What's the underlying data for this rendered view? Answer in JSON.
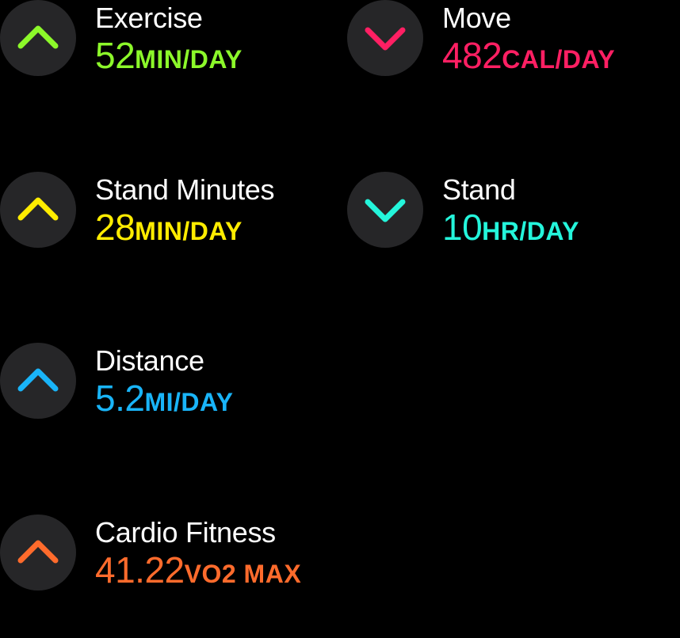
{
  "trends": [
    {
      "id": "exercise",
      "title": "Exercise",
      "value": "52",
      "unit": "MIN/DAY",
      "color": "#8cf82a",
      "direction": "up",
      "icon": "chevron-up-icon"
    },
    {
      "id": "move",
      "title": "Move",
      "value": "482",
      "unit": "CAL/DAY",
      "color": "#ff1f63",
      "direction": "down",
      "icon": "chevron-down-icon"
    },
    {
      "id": "stand-minutes",
      "title": "Stand Minutes",
      "value": "28",
      "unit": "MIN/DAY",
      "color": "#ffec00",
      "direction": "up",
      "icon": "chevron-up-icon"
    },
    {
      "id": "stand",
      "title": "Stand",
      "value": "10",
      "unit": "HR/DAY",
      "color": "#24f5db",
      "direction": "down",
      "icon": "chevron-down-icon"
    },
    {
      "id": "distance",
      "title": "Distance",
      "value": "5.2",
      "unit": "MI/DAY",
      "color": "#19b4f8",
      "direction": "up",
      "icon": "chevron-up-icon"
    },
    {
      "id": "cardio-fitness",
      "title": "Cardio Fitness",
      "value": "41.22",
      "unit": "VO2 MAX",
      "color": "#ff6b2c",
      "direction": "up",
      "icon": "chevron-up-icon"
    }
  ]
}
